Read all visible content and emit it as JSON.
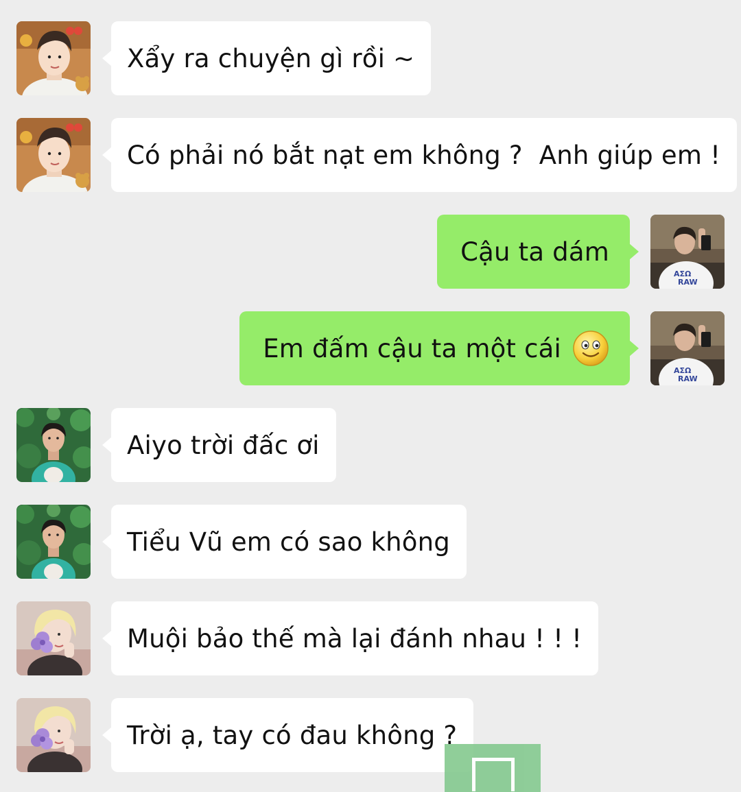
{
  "colors": {
    "background": "#ededed",
    "incoming_bubble": "#ffffff",
    "outgoing_bubble": "#95ec69"
  },
  "messages": [
    {
      "side": "left",
      "avatar": "avatar-boy-stickers",
      "text": "Xẩy ra chuyện gì rồi ~"
    },
    {
      "side": "left",
      "avatar": "avatar-boy-stickers",
      "text": "Có phải nó bắt nạt em không ?  Anh giúp em !"
    },
    {
      "side": "right",
      "avatar": "avatar-boy-mirror-selfie",
      "text": "Cậu ta dám"
    },
    {
      "side": "right",
      "avatar": "avatar-boy-mirror-selfie",
      "text": "Em đấm cậu ta một cái",
      "emoji": "smiley-emoji"
    },
    {
      "side": "left",
      "avatar": "avatar-boy-leaves",
      "text": "Aiyo trời đấc ơi"
    },
    {
      "side": "left",
      "avatar": "avatar-boy-leaves",
      "text": "Tiểu Vũ em có sao không"
    },
    {
      "side": "left",
      "avatar": "avatar-blonde-flower",
      "text": "Muội bảo thế mà lại đánh nhau ! ! !"
    },
    {
      "side": "left",
      "avatar": "avatar-blonde-flower",
      "text": "Trời ạ, tay có đau không ?"
    }
  ]
}
